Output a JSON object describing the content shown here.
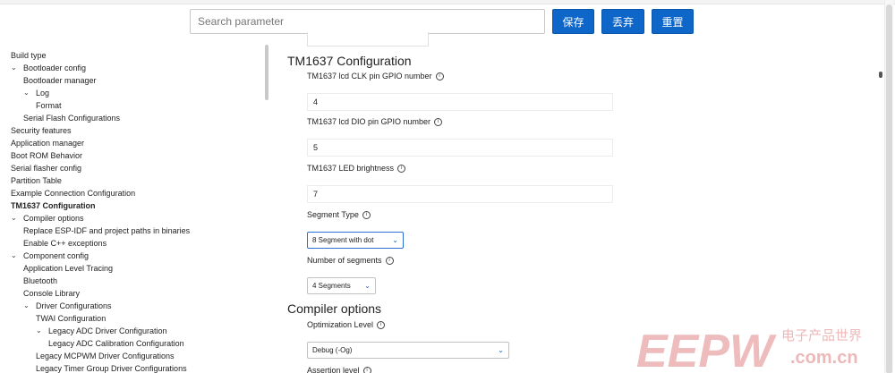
{
  "search": {
    "placeholder": "Search parameter"
  },
  "toolbar": {
    "save_label": "保存",
    "discard_label": "丢弃",
    "reset_label": "重置"
  },
  "sidebar": {
    "items": [
      {
        "label": "Build type",
        "chevron": ""
      },
      {
        "label": "Bootloader config",
        "chevron": "⌄"
      },
      {
        "label": "Bootloader manager",
        "chevron": ""
      },
      {
        "label": "Log",
        "chevron": "⌄"
      },
      {
        "label": "Format",
        "chevron": ""
      },
      {
        "label": "Serial Flash Configurations",
        "chevron": ""
      },
      {
        "label": "Security features",
        "chevron": ""
      },
      {
        "label": "Application manager",
        "chevron": ""
      },
      {
        "label": "Boot ROM Behavior",
        "chevron": ""
      },
      {
        "label": "Serial flasher config",
        "chevron": ""
      },
      {
        "label": "Partition Table",
        "chevron": ""
      },
      {
        "label": "Example Connection Configuration",
        "chevron": ""
      },
      {
        "label": "TM1637 Configuration",
        "chevron": ""
      },
      {
        "label": "Compiler options",
        "chevron": "⌄"
      },
      {
        "label": "Replace ESP-IDF and project paths in binaries",
        "chevron": ""
      },
      {
        "label": "Enable C++ exceptions",
        "chevron": ""
      },
      {
        "label": "Component config",
        "chevron": "⌄"
      },
      {
        "label": "Application Level Tracing",
        "chevron": ""
      },
      {
        "label": "Bluetooth",
        "chevron": ""
      },
      {
        "label": "Console Library",
        "chevron": ""
      },
      {
        "label": "Driver Configurations",
        "chevron": "⌄"
      },
      {
        "label": "TWAI Configuration",
        "chevron": ""
      },
      {
        "label": "Legacy ADC Driver Configuration",
        "chevron": "⌄"
      },
      {
        "label": "Legacy ADC Calibration Configuration",
        "chevron": ""
      },
      {
        "label": "Legacy MCPWM Driver Configurations",
        "chevron": ""
      },
      {
        "label": "Legacy Timer Group Driver Configurations",
        "chevron": ""
      }
    ]
  },
  "main": {
    "tm1637": {
      "title": "TM1637 Configuration",
      "clk_label": "TM1637 lcd CLK pin GPIO number",
      "clk_value": "4",
      "dio_label": "TM1637 lcd DIO pin GPIO number",
      "dio_value": "5",
      "brightness_label": "TM1637 LED brightness",
      "brightness_value": "7",
      "segment_type_label": "Segment Type",
      "segment_type_value": "8 Segment with dot",
      "num_segments_label": "Number of segments",
      "num_segments_value": "4 Segments"
    },
    "compiler": {
      "title": "Compiler options",
      "opt_label": "Optimization Level",
      "opt_value": "Debug (-Og)",
      "assert_label": "Assertion level"
    },
    "info_glyph": "i"
  },
  "watermark": {
    "brand": "EEPW",
    "cn": "电子产品世界",
    "domain": ".com.cn"
  },
  "colors": {
    "accent": "#0f66c9",
    "watermark": "#e8a6a6"
  }
}
